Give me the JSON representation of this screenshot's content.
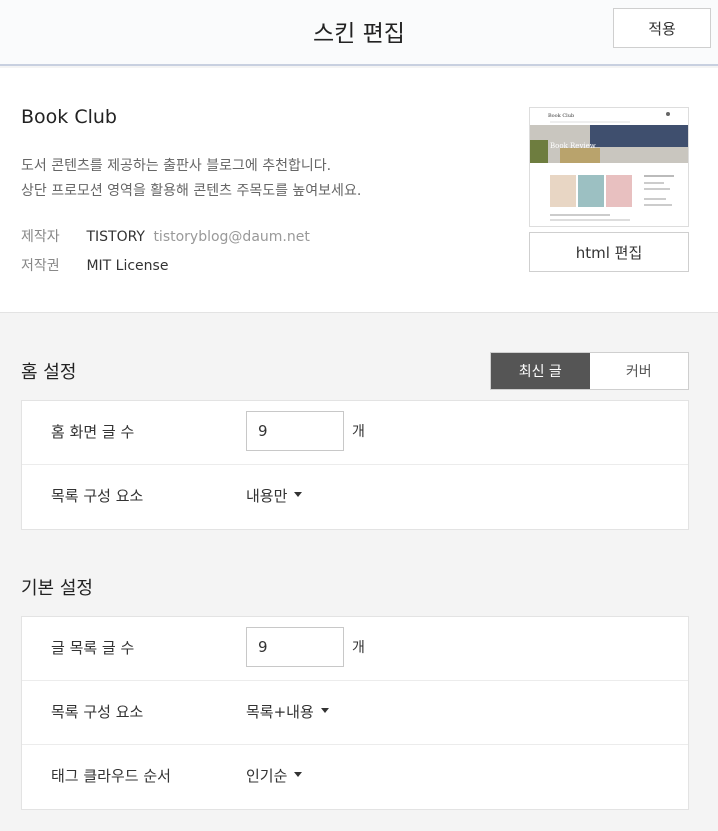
{
  "header": {
    "title": "스킨 편집",
    "apply_label": "적용"
  },
  "skin": {
    "name": "Book Club",
    "desc_line1": "도서 콘텐츠를 제공하는 출판사 블로그에 추천합니다.",
    "desc_line2": "상단 프로모션 영역을 활용해 콘텐츠 주목도를 높여보세요.",
    "author_label": "제작자",
    "author": "TISTORY",
    "author_email": "tistoryblog@daum.net",
    "license_label": "저작권",
    "license": "MIT License",
    "thumbnail": {
      "blog_title": "Book Club",
      "banner_text": "Book Review"
    },
    "html_edit_label": "html 편집"
  },
  "home": {
    "title": "홈 설정",
    "toggle": {
      "options": [
        "최신 글",
        "커버"
      ],
      "selected": "최신 글"
    },
    "post_count_label": "홈 화면 글 수",
    "post_count": "9",
    "unit": "개",
    "list_elements_label": "목록 구성 요소",
    "list_elements_value": "내용만"
  },
  "basic": {
    "title": "기본 설정",
    "post_count_label": "글 목록 글 수",
    "post_count": "9",
    "unit": "개",
    "list_elements_label": "목록 구성 요소",
    "list_elements_value": "목록+내용",
    "tag_cloud_label": "태그 클라우드 순서",
    "tag_cloud_value": "인기순"
  },
  "colors": {
    "toggle_active_bg": "#555555",
    "header_border": "#c8d0e0",
    "page_bg": "#f4f4f4"
  }
}
